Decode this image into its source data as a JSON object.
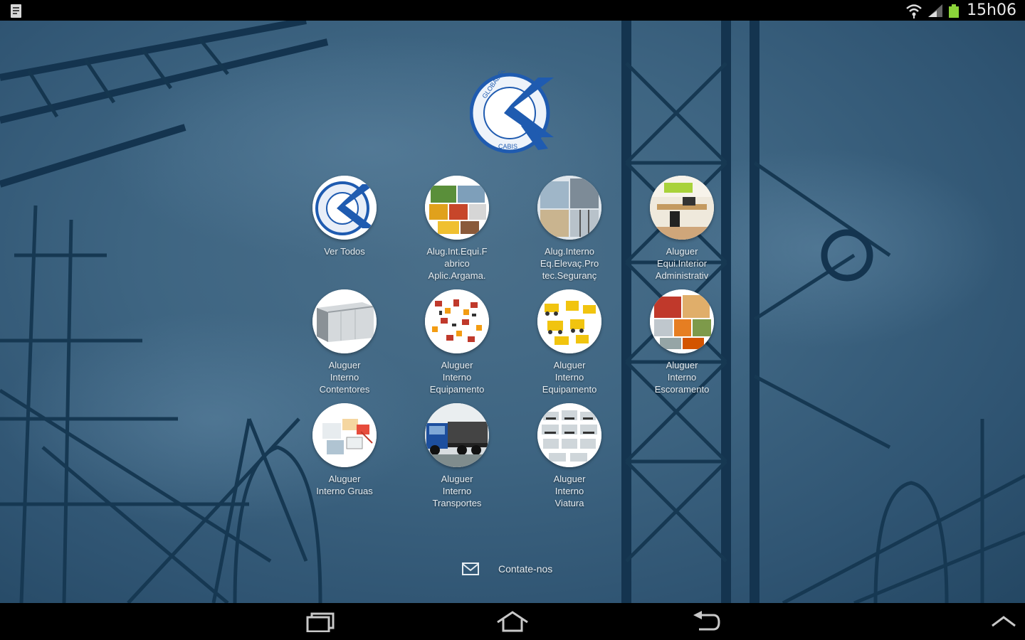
{
  "status_bar": {
    "time": "15h06",
    "icons": [
      "notification-icon",
      "wifi-icon",
      "signal-icon",
      "battery-icon"
    ]
  },
  "logo": {
    "name": "global-sourcing-logo-icon",
    "text_top": "GLOBAL SOURCING",
    "text_bottom": "CABIS"
  },
  "menu": {
    "items": [
      {
        "label": "Ver Todos",
        "image": "logo-thumbnail"
      },
      {
        "label": "Alug.Int.Equi.F\nabrico\nAplic.Argama.",
        "image": "factory-equipment-thumbnail"
      },
      {
        "label": "Alug.Interno\nEq.Elevaç.Pro\ntec.Seguranç",
        "image": "lifting-equipment-thumbnail"
      },
      {
        "label": "Aluguer\nEqui.Interior\nAdministrativ",
        "image": "office-interior-thumbnail"
      },
      {
        "label": "Aluguer\nInterno\nContentores",
        "image": "container-thumbnail"
      },
      {
        "label": "Aluguer\nInterno\nEquipamento",
        "image": "tools-thumbnail"
      },
      {
        "label": "Aluguer\nInterno\nEquipamento",
        "image": "machinery-thumbnail"
      },
      {
        "label": "Aluguer\nInterno\nEscoramento",
        "image": "shoring-thumbnail"
      },
      {
        "label": "Aluguer\nInterno Gruas",
        "image": "crane-thumbnail"
      },
      {
        "label": "Aluguer\nInterno\nTransportes",
        "image": "truck-thumbnail"
      },
      {
        "label": "Aluguer\nInterno\nViatura",
        "image": "vehicles-thumbnail"
      }
    ]
  },
  "contact": {
    "label": "Contate-nos",
    "icon": "envelope-icon"
  },
  "nav_bar": {
    "buttons": [
      "recent-apps-icon",
      "home-icon",
      "back-icon",
      "chevron-up-icon"
    ]
  },
  "colors": {
    "background": "#3e6582",
    "label_text": "#e6edf2",
    "logo_blue": "#1f5bb0"
  }
}
